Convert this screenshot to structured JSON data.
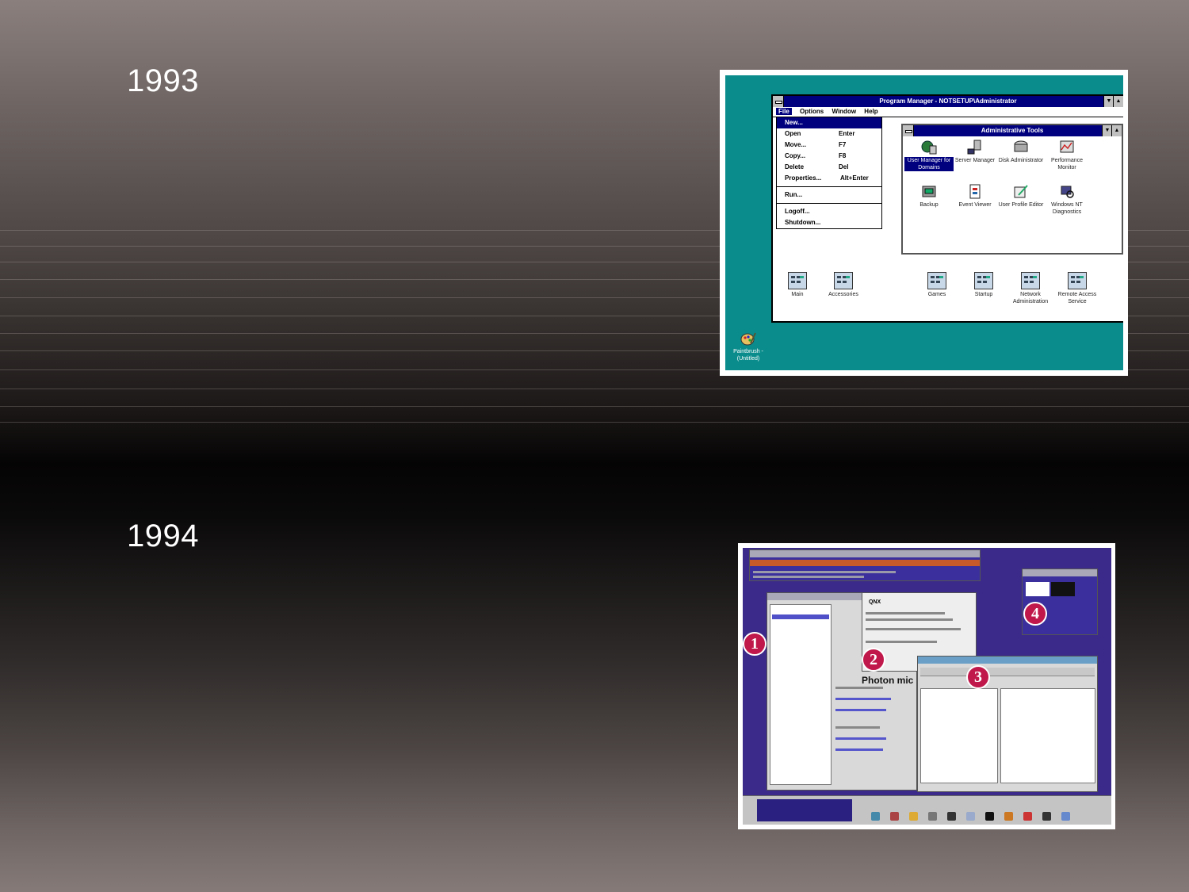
{
  "slide": {
    "year1": "1993",
    "year2": "1994"
  },
  "winnt": {
    "program_manager_title": "Program Manager - NOTSETUP\\Administrator",
    "menu": [
      "File",
      "Options",
      "Window",
      "Help"
    ],
    "file_menu": [
      {
        "label": "New...",
        "shortcut": ""
      },
      {
        "label": "Open",
        "shortcut": "Enter"
      },
      {
        "label": "Move...",
        "shortcut": "F7"
      },
      {
        "label": "Copy...",
        "shortcut": "F8"
      },
      {
        "label": "Delete",
        "shortcut": "Del"
      },
      {
        "label": "Properties...",
        "shortcut": "Alt+Enter"
      },
      {
        "label": "Run...",
        "shortcut": ""
      },
      {
        "label": "Logoff...",
        "shortcut": ""
      },
      {
        "label": "Shutdown...",
        "shortcut": ""
      }
    ],
    "admin_tools_title": "Administrative Tools",
    "admin_icons": [
      {
        "label": "User Manager for Domains",
        "icon": "user-manager-icon"
      },
      {
        "label": "Server Manager",
        "icon": "server-manager-icon"
      },
      {
        "label": "Disk Administrator",
        "icon": "disk-administrator-icon"
      },
      {
        "label": "Performance Monitor",
        "icon": "performance-monitor-icon"
      },
      {
        "label": "Backup",
        "icon": "backup-icon"
      },
      {
        "label": "Event Viewer",
        "icon": "event-viewer-icon"
      },
      {
        "label": "User Profile Editor",
        "icon": "user-profile-editor-icon"
      },
      {
        "label": "Windows NT Diagnostics",
        "icon": "diagnostics-icon"
      }
    ],
    "group_icons": [
      "Main",
      "Accessories",
      "Games",
      "Startup",
      "Network Administration",
      "Remote Access Service"
    ],
    "desktop_icon": "Paintbrush - (Untitled)",
    "colors": {
      "desktop": "#0b8c8c",
      "titlebar": "#00007f"
    }
  },
  "qnx": {
    "photon_label": "Photon mic",
    "qnx_label": "QNX",
    "badges": [
      "1",
      "2",
      "3",
      "4"
    ],
    "colors": {
      "desktop": "#3b2a8a",
      "badge": "#c0184a"
    }
  }
}
